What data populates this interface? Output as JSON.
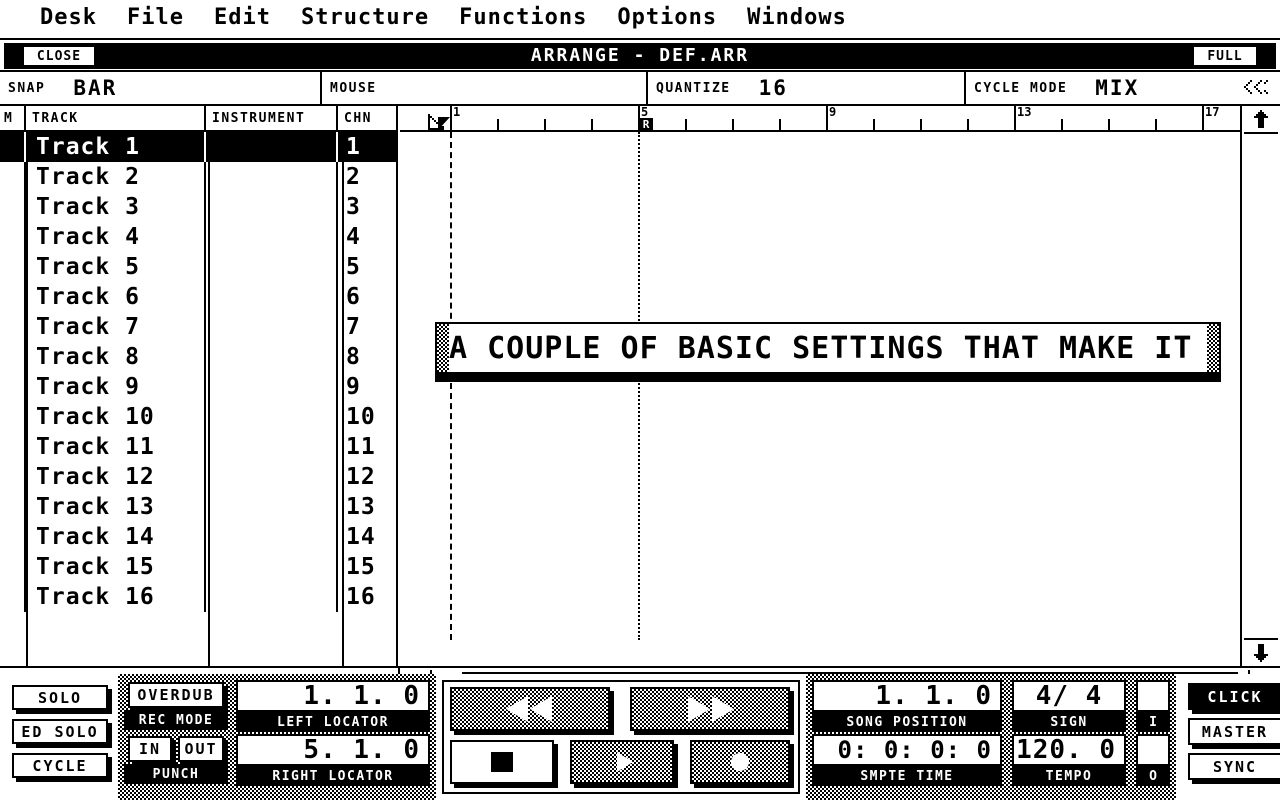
{
  "menubar": {
    "items": [
      {
        "label": "Desk"
      },
      {
        "label": "File"
      },
      {
        "label": "Edit"
      },
      {
        "label": "Structure"
      },
      {
        "label": "Functions"
      },
      {
        "label": "Options"
      },
      {
        "label": "Windows"
      }
    ]
  },
  "window": {
    "close_label": "CLOSE",
    "title": "ARRANGE  -  DEF.ARR",
    "full_label": "FULL"
  },
  "infobar": {
    "snap_label": "SNAP",
    "snap_value": "BAR",
    "mouse_label": "MOUSE",
    "mouse_value": "",
    "quantize_label": "QUANTIZE",
    "quantize_value": "16",
    "cycle_mode_label": "CYCLE MODE",
    "cycle_mode_value": "MIX",
    "midi_indicator_icon": "midi-activity-icon"
  },
  "tracklist": {
    "headers": {
      "mute": "M",
      "track": "TRACK",
      "instrument": "INSTRUMENT",
      "channel": "CHN"
    },
    "selected_index": 0,
    "rows": [
      {
        "mute": "",
        "track": "Track 1",
        "instrument": "",
        "chn": "1"
      },
      {
        "mute": "",
        "track": "Track 2",
        "instrument": "",
        "chn": "2"
      },
      {
        "mute": "",
        "track": "Track 3",
        "instrument": "",
        "chn": "3"
      },
      {
        "mute": "",
        "track": "Track 4",
        "instrument": "",
        "chn": "4"
      },
      {
        "mute": "",
        "track": "Track 5",
        "instrument": "",
        "chn": "5"
      },
      {
        "mute": "",
        "track": "Track 6",
        "instrument": "",
        "chn": "6"
      },
      {
        "mute": "",
        "track": "Track 7",
        "instrument": "",
        "chn": "7"
      },
      {
        "mute": "",
        "track": "Track 8",
        "instrument": "",
        "chn": "8"
      },
      {
        "mute": "",
        "track": "Track 9",
        "instrument": "",
        "chn": "9"
      },
      {
        "mute": "",
        "track": "Track 10",
        "instrument": "",
        "chn": "10"
      },
      {
        "mute": "",
        "track": "Track 11",
        "instrument": "",
        "chn": "11"
      },
      {
        "mute": "",
        "track": "Track 12",
        "instrument": "",
        "chn": "12"
      },
      {
        "mute": "",
        "track": "Track 13",
        "instrument": "",
        "chn": "13"
      },
      {
        "mute": "",
        "track": "Track 14",
        "instrument": "",
        "chn": "14"
      },
      {
        "mute": "",
        "track": "Track 15",
        "instrument": "",
        "chn": "15"
      },
      {
        "mute": "",
        "track": "Track 16",
        "instrument": "",
        "chn": "16"
      }
    ]
  },
  "ruler": {
    "bars": [
      "1",
      "5",
      "9",
      "13",
      "17"
    ],
    "left_locator_marker": "L",
    "right_locator_marker": "R",
    "left_locator_bar": "1",
    "right_locator_bar": "5"
  },
  "arrange": {
    "part_text": "A COUPLE OF BASIC SETTINGS THAT MAKE IT EASIER TO WORK"
  },
  "scrollbars": {
    "up_icon": "arrow-up-icon",
    "down_icon": "arrow-down-icon",
    "left_icon": "arrow-left-icon",
    "right_icon": "arrow-right-icon"
  },
  "transport": {
    "solo": "SOLO",
    "ed_solo": "ED SOLO",
    "cycle": "CYCLE",
    "rec_mode_value": "OVERDUB",
    "rec_mode_label": "REC MODE",
    "punch_in": "IN",
    "punch_out": "OUT",
    "punch_label": "PUNCH",
    "left_locator_value": "1. 1.    0",
    "left_locator_label": "LEFT LOCATOR",
    "right_locator_value": "5. 1.    0",
    "right_locator_label": "RIGHT LOCATOR",
    "rewind_icon": "rewind-icon",
    "forward_icon": "fast-forward-icon",
    "stop_icon": "stop-icon",
    "play_icon": "play-icon",
    "record_icon": "record-icon",
    "song_position_value": "1. 1.    0",
    "song_position_label": "SONG POSITION",
    "smpte_value": "0: 0: 0: 0",
    "smpte_label": "SMPTE TIME",
    "sign_value": "4/ 4",
    "sign_label": "SIGN",
    "tempo_value": "120.    0",
    "tempo_label": "TEMPO",
    "midi_in_label": "I",
    "midi_in_value": "",
    "midi_out_label": "O",
    "midi_out_value": "",
    "click": "CLICK",
    "master": "MASTER",
    "sync": "SYNC",
    "click_active": true
  },
  "colors": {
    "foreground": "#000000",
    "background": "#ffffff"
  }
}
